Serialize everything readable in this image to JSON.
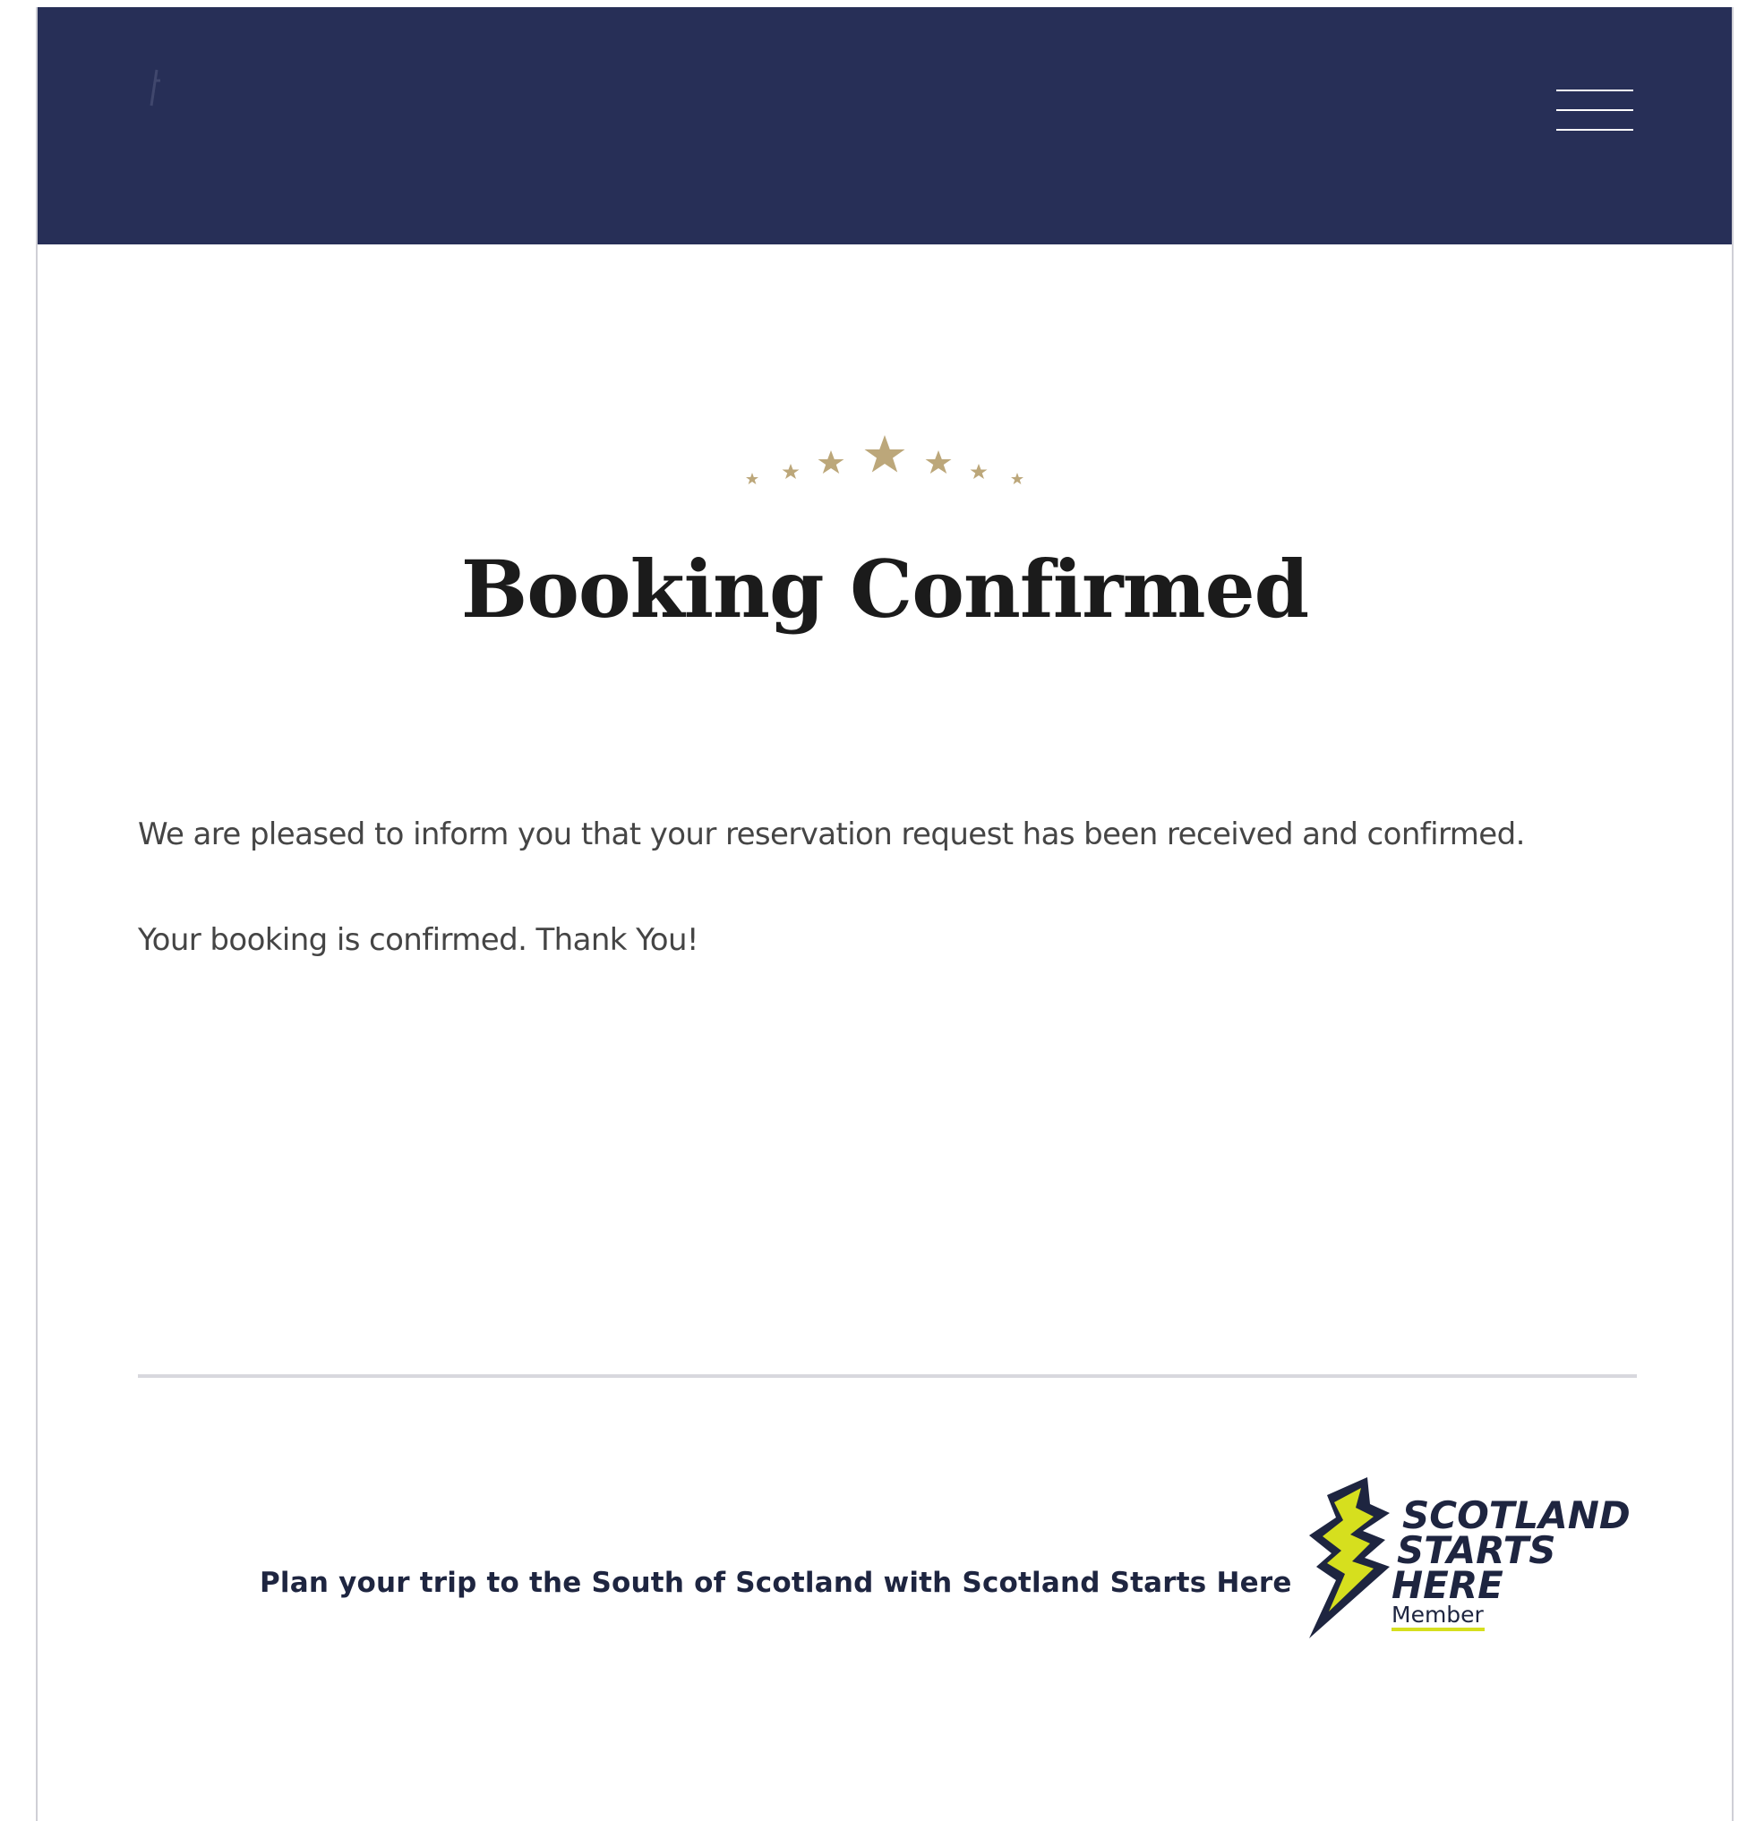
{
  "header": {
    "background_color": "#272f57",
    "menu_icon": "hamburger-menu-icon"
  },
  "decoration": {
    "stars_icon": "stars-icon",
    "star_color": "#bca77a"
  },
  "main": {
    "title": "Booking Confirmed",
    "message": "We are pleased to inform you that your reservation request has been received and confirmed.",
    "confirmation": "Your booking is confirmed. Thank You!"
  },
  "footer": {
    "promo_text": "Plan your trip to the South of Scotland with Scotland Starts Here",
    "logo": {
      "icon": "lightning-bolt-icon",
      "line1": "SCOTLAND",
      "line2": "STARTS",
      "line3": "HERE",
      "line4": "Member",
      "accent_color": "#d6df1e",
      "text_color": "#1e2540"
    }
  }
}
